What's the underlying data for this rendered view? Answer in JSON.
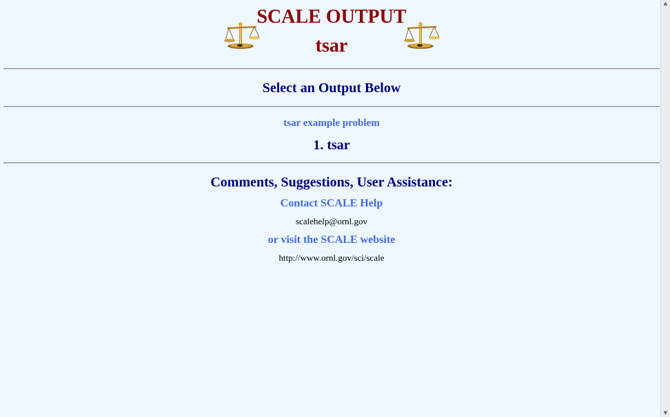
{
  "header": {
    "title": "SCALE OUTPUT",
    "subtitle": "tsar",
    "left_icon": "balance-scale-icon",
    "right_icon": "balance-scale-icon"
  },
  "outputs": {
    "heading": "Select an Output Below",
    "problem_link": "tsar example problem",
    "items": [
      {
        "label": "1. tsar"
      }
    ]
  },
  "support": {
    "heading": "Comments, Suggestions, User Assistance:",
    "contact_link": "Contact SCALE Help",
    "email": "scalehelp@ornl.gov",
    "visit_link": "or visit the SCALE website",
    "url": "http://www.ornl.gov/sci/scale"
  },
  "colors": {
    "background": "#eef7fe",
    "title": "#8b0000",
    "heading": "#000080",
    "link": "#4169e1"
  }
}
